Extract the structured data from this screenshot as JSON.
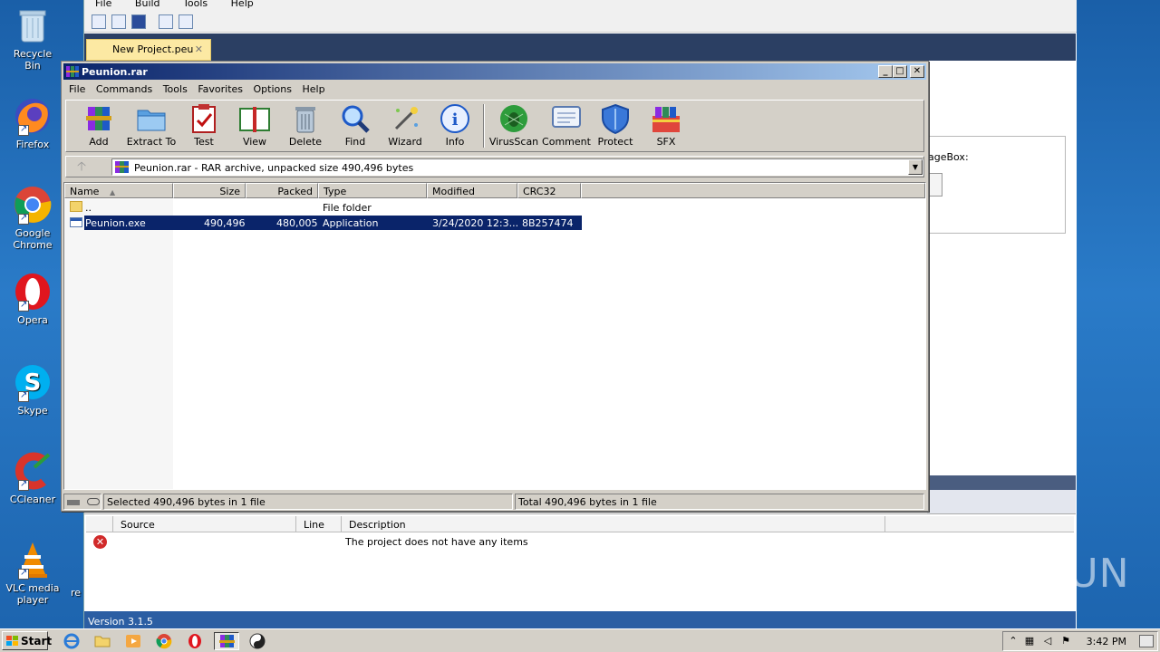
{
  "desktop": {
    "icons": [
      {
        "label": "Recycle Bin"
      },
      {
        "label": "Firefox"
      },
      {
        "label": "Google Chrome"
      },
      {
        "label": "Opera"
      },
      {
        "label": "Skype"
      },
      {
        "label": "CCleaner"
      },
      {
        "label": "VLC media player"
      }
    ],
    "partial_label": "re"
  },
  "bg_app": {
    "menu": [
      "File",
      "Build",
      "Tools",
      "Help"
    ],
    "tab_label": "New Project.peu",
    "tab_close": "✕",
    "panel_label": "ageBox:",
    "errors": {
      "columns": [
        "Source",
        "Line",
        "Description"
      ],
      "message": "The project does not have any items",
      "error_glyph": "✕"
    },
    "version": "Version 3.1.5"
  },
  "winrar": {
    "title": "Peunion.rar",
    "controls": {
      "minimize": "_",
      "maximize": "□",
      "close": "✕"
    },
    "menu": [
      "File",
      "Commands",
      "Tools",
      "Favorites",
      "Options",
      "Help"
    ],
    "toolbar": [
      {
        "label": "Add",
        "icon": "add-archive-icon"
      },
      {
        "label": "Extract To",
        "icon": "extract-folder-icon"
      },
      {
        "label": "Test",
        "icon": "test-clipboard-icon"
      },
      {
        "label": "View",
        "icon": "view-book-icon"
      },
      {
        "label": "Delete",
        "icon": "trash-icon"
      },
      {
        "label": "Find",
        "icon": "magnifier-icon"
      },
      {
        "label": "Wizard",
        "icon": "magic-wand-icon"
      },
      {
        "label": "Info",
        "icon": "info-icon"
      },
      {
        "label": "VirusScan",
        "icon": "bug-icon"
      },
      {
        "label": "Comment",
        "icon": "comment-icon"
      },
      {
        "label": "Protect",
        "icon": "shield-icon"
      },
      {
        "label": "SFX",
        "icon": "sfx-icon"
      }
    ],
    "address": "Peunion.rar - RAR archive, unpacked size 490,496 bytes",
    "up_glyph": "🡡",
    "dropdown_glyph": "▼",
    "columns": {
      "name": "Name",
      "sort_glyph": "▲",
      "size": "Size",
      "packed": "Packed",
      "type": "Type",
      "modified": "Modified",
      "crc": "CRC32"
    },
    "rows": [
      {
        "name": "..",
        "size": "",
        "packed": "",
        "type": "File folder",
        "modified": "",
        "crc": ""
      },
      {
        "name": "Peunion.exe",
        "size": "490,496",
        "packed": "480,005",
        "type": "Application",
        "modified": "3/24/2020 12:3...",
        "crc": "8B257474"
      }
    ],
    "status_left": "Selected 490,496 bytes in 1 file",
    "status_right": "Total 490,496 bytes in 1 file"
  },
  "taskbar": {
    "start": "Start",
    "clock": "3:42 PM"
  },
  "watermark": "ANY RUN"
}
